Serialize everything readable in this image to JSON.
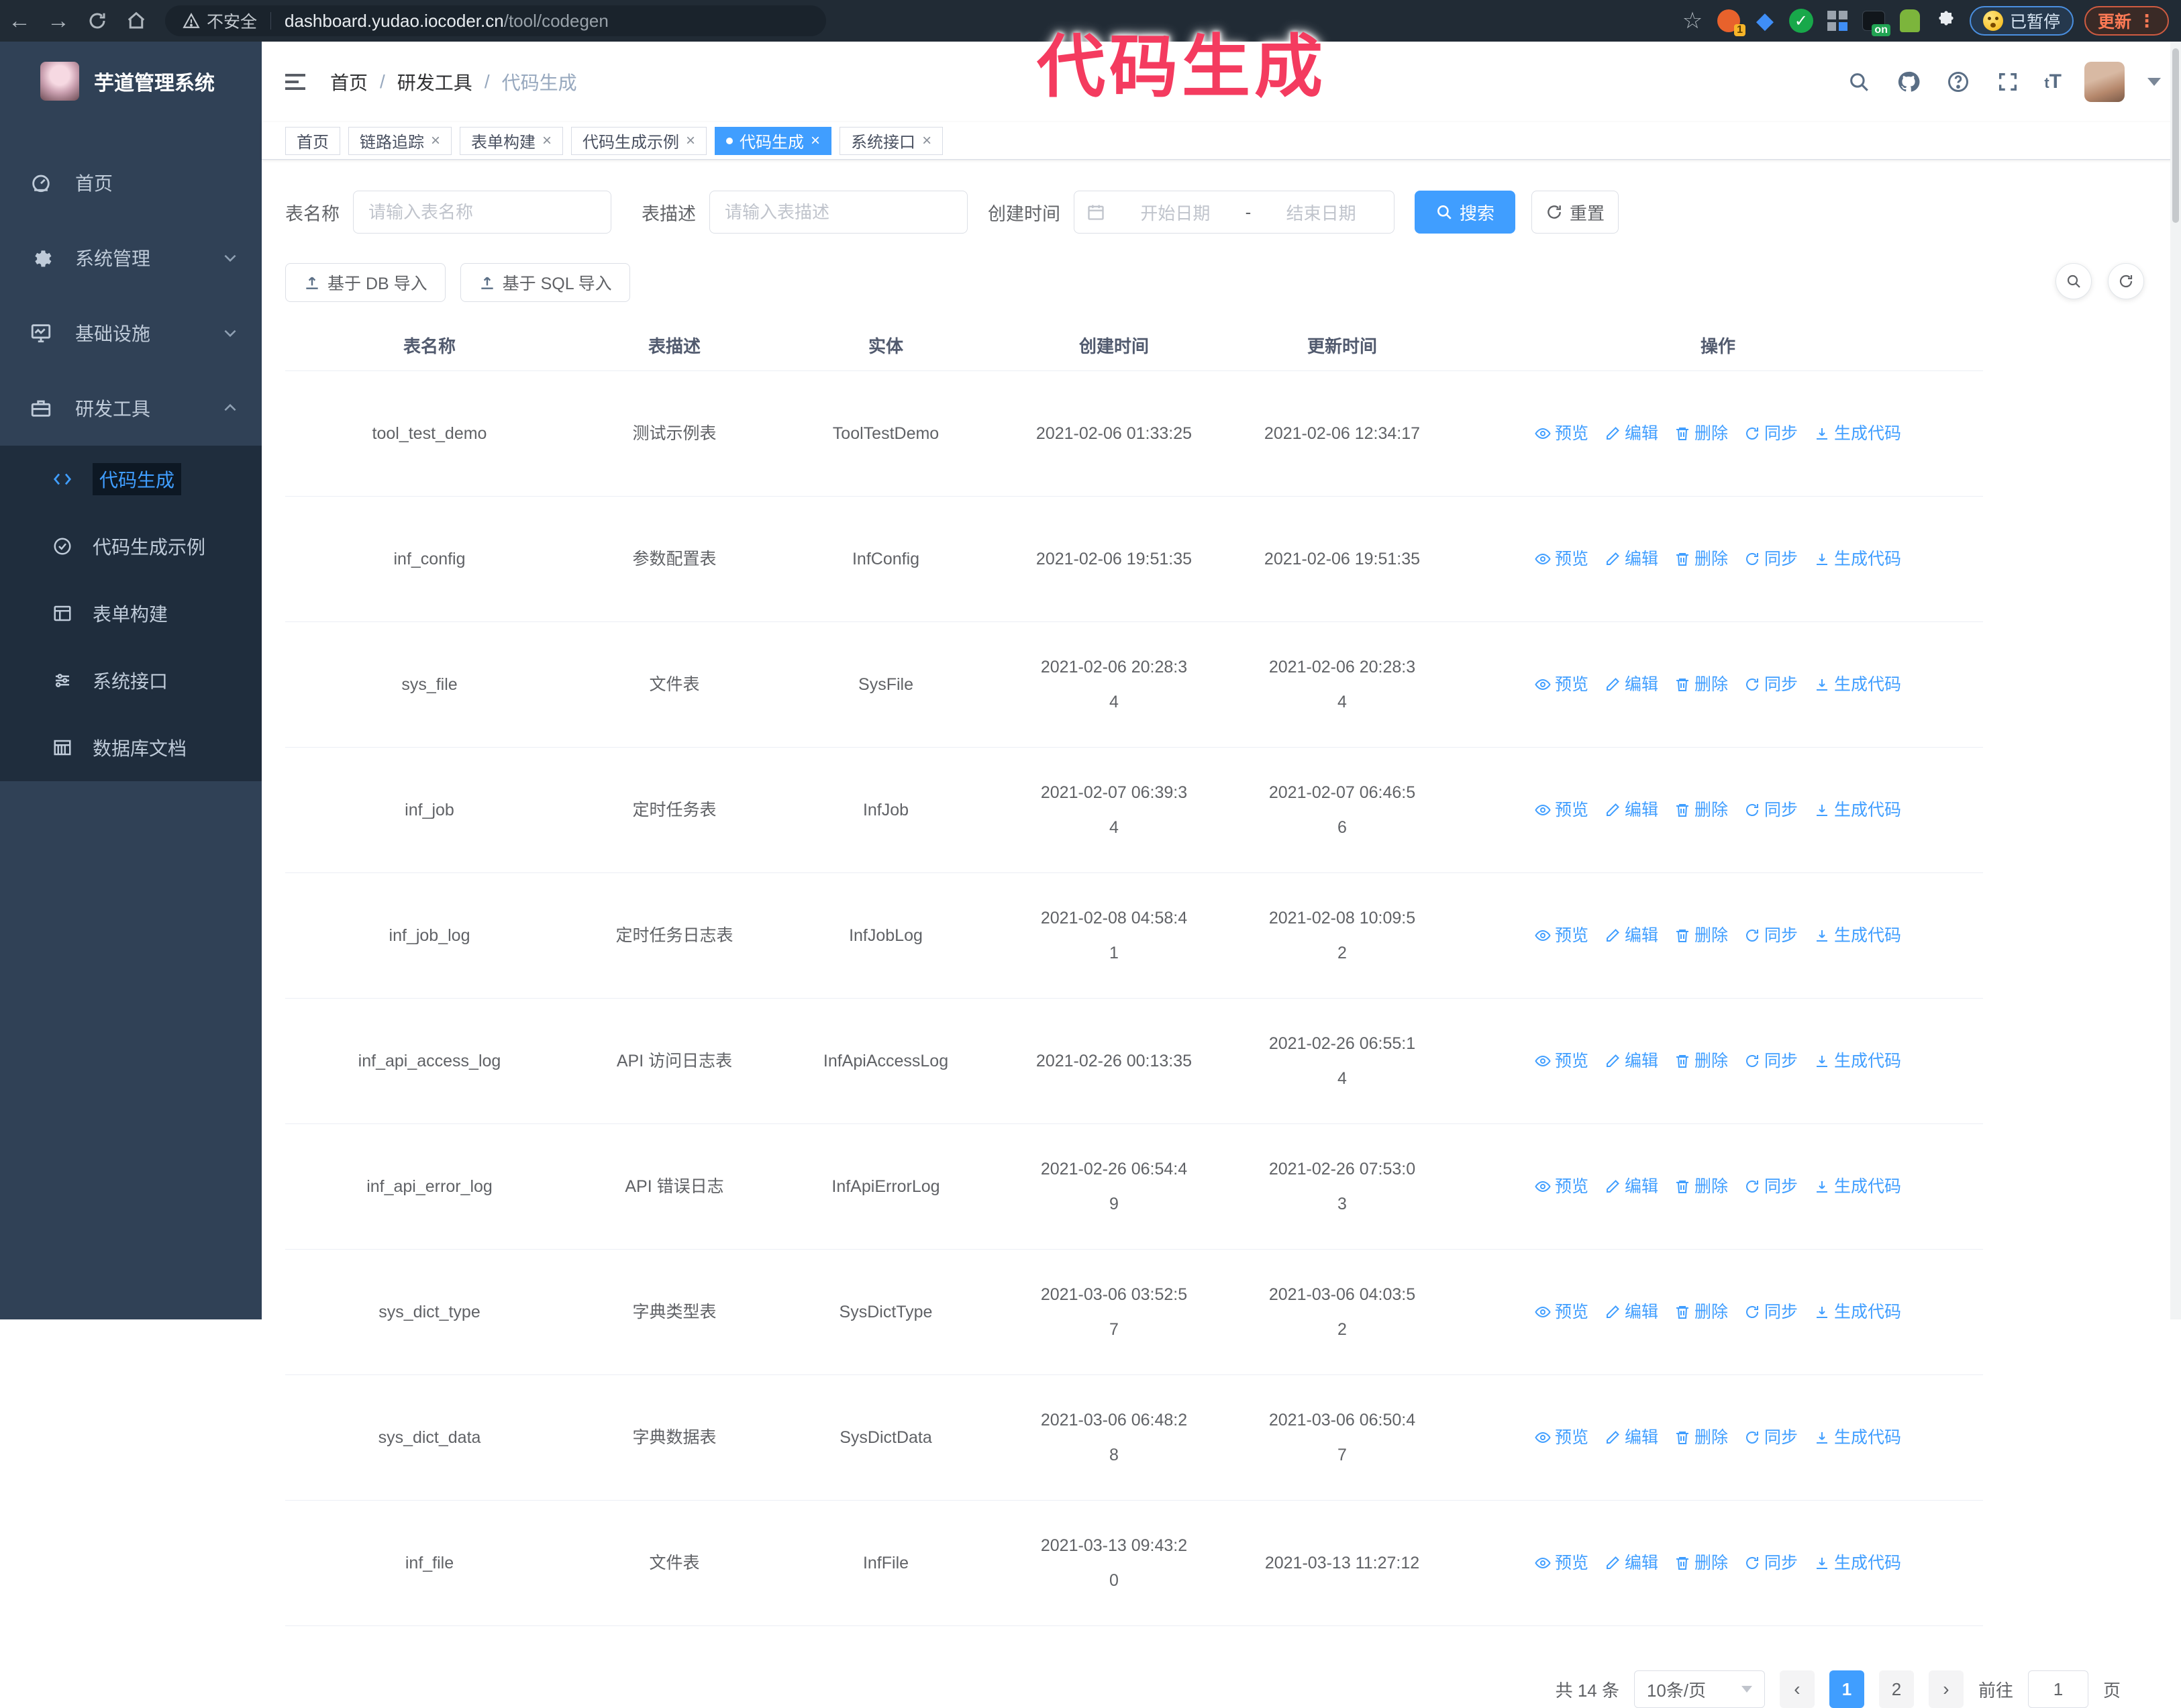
{
  "colors": {
    "accent": "#409EFF",
    "annotation": "#F43B5F",
    "sidebar_bg": "#304156",
    "chrome_bg": "#212B35"
  },
  "browser": {
    "security_label": "不安全",
    "url_host": "dashboard.yudao.iocoder.cn",
    "url_path": "/tool/codegen",
    "extension_badge_1": "1",
    "extension_badge_on": "on",
    "paused_chip": "已暂停",
    "update_button": "更新"
  },
  "annotation": {
    "text": "代码生成"
  },
  "sidebar": {
    "app_title": "芋道管理系统",
    "items": [
      {
        "label": "首页"
      },
      {
        "label": "系统管理"
      },
      {
        "label": "基础设施"
      },
      {
        "label": "研发工具"
      }
    ],
    "subitems": [
      {
        "label": "代码生成"
      },
      {
        "label": "代码生成示例"
      },
      {
        "label": "表单构建"
      },
      {
        "label": "系统接口"
      },
      {
        "label": "数据库文档"
      }
    ]
  },
  "header": {
    "breadcrumb": [
      "首页",
      "研发工具",
      "代码生成"
    ],
    "separator": "/"
  },
  "tabs": [
    {
      "label": "首页"
    },
    {
      "label": "链路追踪"
    },
    {
      "label": "表单构建"
    },
    {
      "label": "代码生成示例"
    },
    {
      "label": "代码生成"
    },
    {
      "label": "系统接口"
    }
  ],
  "filters": {
    "table_name_label": "表名称",
    "table_name_placeholder": "请输入表名称",
    "table_desc_label": "表描述",
    "table_desc_placeholder": "请输入表描述",
    "create_time_label": "创建时间",
    "date_start_placeholder": "开始日期",
    "date_separator": "-",
    "date_end_placeholder": "结束日期",
    "search_button": "搜索",
    "reset_button": "重置"
  },
  "toolbar": {
    "import_db_button": "基于 DB 导入",
    "import_sql_button": "基于 SQL 导入"
  },
  "table": {
    "headers": [
      "表名称",
      "表描述",
      "实体",
      "创建时间",
      "更新时间",
      "操作"
    ],
    "action_labels": [
      "预览",
      "编辑",
      "删除",
      "同步",
      "生成代码"
    ],
    "rows": [
      {
        "name": "tool_test_demo",
        "desc": "测试示例表",
        "entity": "ToolTestDemo",
        "created": "2021-02-06 01:33:25",
        "updated": "2021-02-06 12:34:17"
      },
      {
        "name": "inf_config",
        "desc": "参数配置表",
        "entity": "InfConfig",
        "created": "2021-02-06 19:51:35",
        "updated": "2021-02-06 19:51:35"
      },
      {
        "name": "sys_file",
        "desc": "文件表",
        "entity": "SysFile",
        "created": "2021-02-06 20:28:3\n4",
        "updated": "2021-02-06 20:28:3\n4"
      },
      {
        "name": "inf_job",
        "desc": "定时任务表",
        "entity": "InfJob",
        "created": "2021-02-07 06:39:3\n4",
        "updated": "2021-02-07 06:46:5\n6"
      },
      {
        "name": "inf_job_log",
        "desc": "定时任务日志表",
        "entity": "InfJobLog",
        "created": "2021-02-08 04:58:4\n1",
        "updated": "2021-02-08 10:09:5\n2"
      },
      {
        "name": "inf_api_access_log",
        "desc": "API 访问日志表",
        "entity": "InfApiAccessLog",
        "created": "2021-02-26 00:13:35",
        "updated": "2021-02-26 06:55:1\n4"
      },
      {
        "name": "inf_api_error_log",
        "desc": "API 错误日志",
        "entity": "InfApiErrorLog",
        "created": "2021-02-26 06:54:4\n9",
        "updated": "2021-02-26 07:53:0\n3"
      },
      {
        "name": "sys_dict_type",
        "desc": "字典类型表",
        "entity": "SysDictType",
        "created": "2021-03-06 03:52:5\n7",
        "updated": "2021-03-06 04:03:5\n2"
      },
      {
        "name": "sys_dict_data",
        "desc": "字典数据表",
        "entity": "SysDictData",
        "created": "2021-03-06 06:48:2\n8",
        "updated": "2021-03-06 06:50:4\n7"
      },
      {
        "name": "inf_file",
        "desc": "文件表",
        "entity": "InfFile",
        "created": "2021-03-13 09:43:2\n0",
        "updated": "2021-03-13 11:27:12"
      }
    ]
  },
  "pagination": {
    "total_text": "共 14 条",
    "page_size": "10条/页",
    "pages": [
      "1",
      "2"
    ],
    "goto_label": "前往",
    "goto_value": "1",
    "goto_suffix": "页"
  }
}
